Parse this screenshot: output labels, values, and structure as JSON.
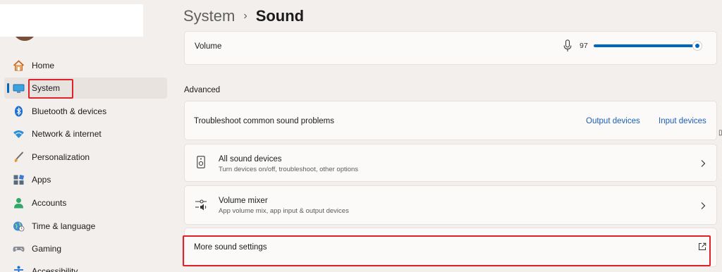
{
  "sidebar": {
    "items": [
      {
        "label": "Home",
        "icon": "home-icon"
      },
      {
        "label": "System",
        "icon": "monitor-icon"
      },
      {
        "label": "Bluetooth & devices",
        "icon": "bluetooth-icon"
      },
      {
        "label": "Network & internet",
        "icon": "wifi-icon"
      },
      {
        "label": "Personalization",
        "icon": "brush-icon"
      },
      {
        "label": "Apps",
        "icon": "apps-icon"
      },
      {
        "label": "Accounts",
        "icon": "person-icon"
      },
      {
        "label": "Time & language",
        "icon": "globe-clock-icon"
      },
      {
        "label": "Gaming",
        "icon": "gamepad-icon"
      },
      {
        "label": "Accessibility",
        "icon": "accessibility-icon"
      }
    ],
    "selected": "System"
  },
  "breadcrumb": {
    "parent": "System",
    "separator": "›",
    "current": "Sound"
  },
  "volume": {
    "label": "Volume",
    "value": "97",
    "level": 0.97
  },
  "advanced": {
    "heading": "Advanced",
    "troubleshoot": {
      "title": "Troubleshoot common sound problems",
      "output_link": "Output devices",
      "input_link": "Input devices"
    },
    "all_devices": {
      "title": "All sound devices",
      "subtitle": "Turn devices on/off, troubleshoot, other options"
    },
    "mixer": {
      "title": "Volume mixer",
      "subtitle": "App volume mix, app input & output devices"
    },
    "more_settings": {
      "title": "More sound settings"
    }
  },
  "colors": {
    "accent": "#0067c0",
    "link": "#1a5fb4",
    "highlight": "#e0202a",
    "background": "#f3efed",
    "card": "#fbfaf9"
  }
}
